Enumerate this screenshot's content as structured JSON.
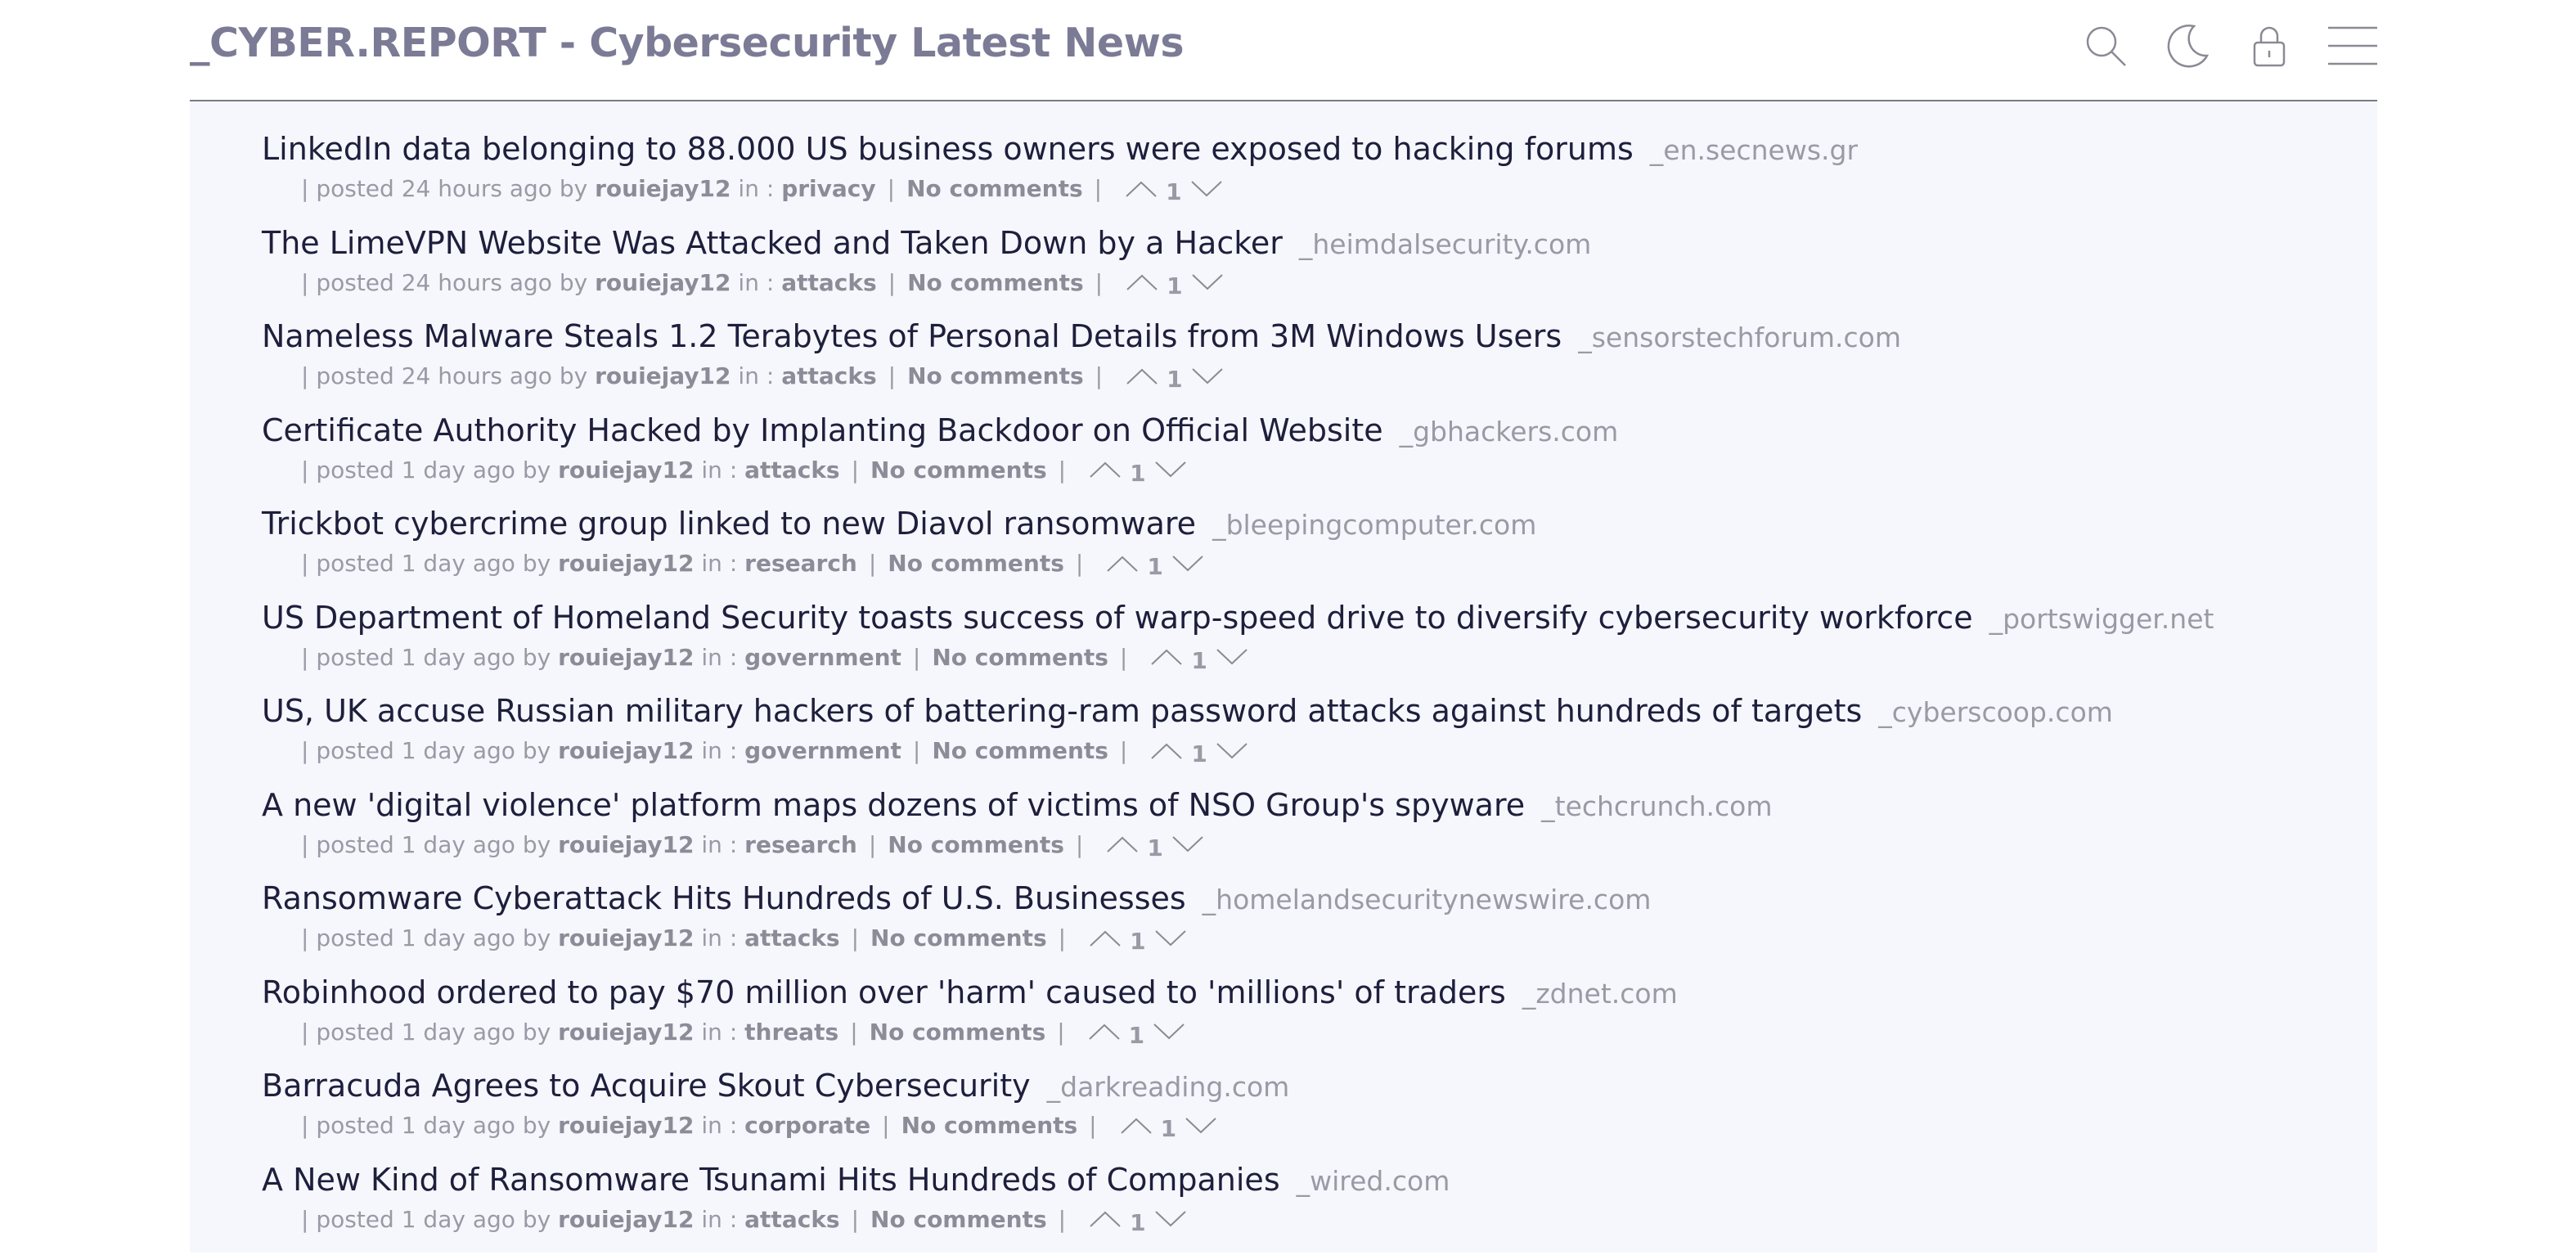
{
  "header": {
    "title": "_CYBER.REPORT - Cybersecurity Latest News",
    "icons": [
      "search-icon",
      "moon-icon",
      "lock-icon",
      "menu-icon"
    ]
  },
  "labels": {
    "posted": "| posted",
    "by": "by",
    "in": "in :",
    "pipe": "|"
  },
  "colors": {
    "title": "#7b7b96",
    "headline": "#1d1f3c",
    "muted": "#9a9aa6",
    "background": "#f6f7fc"
  },
  "posts": [
    {
      "title": "LinkedIn data belonging to 88.000 US business owners were exposed to hacking forums",
      "source": "_en.secnews.gr",
      "time": "24 hours ago",
      "author": "rouiejay12",
      "category": "privacy",
      "comments": "No comments",
      "score": "1"
    },
    {
      "title": "The LimeVPN Website Was Attacked and Taken Down by a Hacker",
      "source": "_heimdalsecurity.com",
      "time": "24 hours ago",
      "author": "rouiejay12",
      "category": "attacks",
      "comments": "No comments",
      "score": "1"
    },
    {
      "title": "Nameless Malware Steals 1.2 Terabytes of Personal Details from 3M Windows Users",
      "source": "_sensorstechforum.com",
      "time": "24 hours ago",
      "author": "rouiejay12",
      "category": "attacks",
      "comments": "No comments",
      "score": "1"
    },
    {
      "title": "Certificate Authority Hacked by Implanting Backdoor on Official Website",
      "source": "_gbhackers.com",
      "time": "1 day ago",
      "author": "rouiejay12",
      "category": "attacks",
      "comments": "No comments",
      "score": "1"
    },
    {
      "title": "Trickbot cybercrime group linked to new Diavol ransomware",
      "source": "_bleepingcomputer.com",
      "time": "1 day ago",
      "author": "rouiejay12",
      "category": "research",
      "comments": "No comments",
      "score": "1"
    },
    {
      "title": "US Department of Homeland Security toasts success of warp-speed drive to diversify cybersecurity workforce",
      "source": "_portswigger.net",
      "time": "1 day ago",
      "author": "rouiejay12",
      "category": "government",
      "comments": "No comments",
      "score": "1"
    },
    {
      "title": "US, UK accuse Russian military hackers of battering-ram password attacks against hundreds of targets",
      "source": "_cyberscoop.com",
      "time": "1 day ago",
      "author": "rouiejay12",
      "category": "government",
      "comments": "No comments",
      "score": "1"
    },
    {
      "title": "A new 'digital violence' platform maps dozens of victims of NSO Group's spyware",
      "source": "_techcrunch.com",
      "time": "1 day ago",
      "author": "rouiejay12",
      "category": "research",
      "comments": "No comments",
      "score": "1"
    },
    {
      "title": "Ransomware Cyberattack Hits Hundreds of U.S. Businesses",
      "source": "_homelandsecuritynewswire.com",
      "time": "1 day ago",
      "author": "rouiejay12",
      "category": "attacks",
      "comments": "No comments",
      "score": "1"
    },
    {
      "title": "Robinhood ordered to pay $70 million over 'harm' caused to 'millions' of traders",
      "source": "_zdnet.com",
      "time": "1 day ago",
      "author": "rouiejay12",
      "category": "threats",
      "comments": "No comments",
      "score": "1"
    },
    {
      "title": "Barracuda Agrees to Acquire Skout Cybersecurity",
      "source": "_darkreading.com",
      "time": "1 day ago",
      "author": "rouiejay12",
      "category": "corporate",
      "comments": "No comments",
      "score": "1"
    },
    {
      "title": "A New Kind of Ransomware Tsunami Hits Hundreds of Companies",
      "source": "_wired.com",
      "time": "1 day ago",
      "author": "rouiejay12",
      "category": "attacks",
      "comments": "No comments",
      "score": "1"
    }
  ]
}
